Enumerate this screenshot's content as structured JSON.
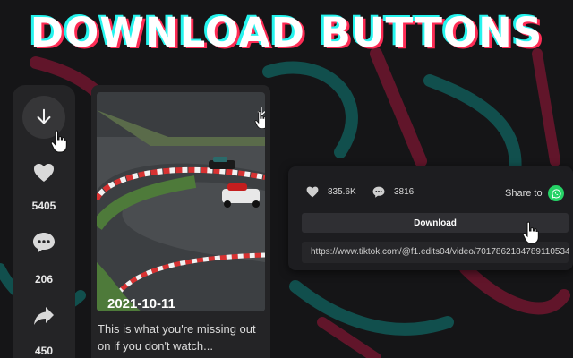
{
  "title": "DOWNLOAD BUTTONS",
  "colors": {
    "cyan": "#25f4ee",
    "pink": "#fe2c55",
    "whatsapp": "#25d366"
  },
  "sidebar": {
    "download_icon": "download-arrow-icon",
    "like_count": "5405",
    "comment_count": "206",
    "share_count": "450"
  },
  "video": {
    "date": "2021-10-11",
    "caption": "This is what you're missing out on if you don't watch..."
  },
  "panel": {
    "likes": "835.6K",
    "comments": "3816",
    "share_label": "Share to",
    "download_label": "Download",
    "url": "https://www.tiktok.com/@f1.edits04/video/7017862184789110534"
  }
}
